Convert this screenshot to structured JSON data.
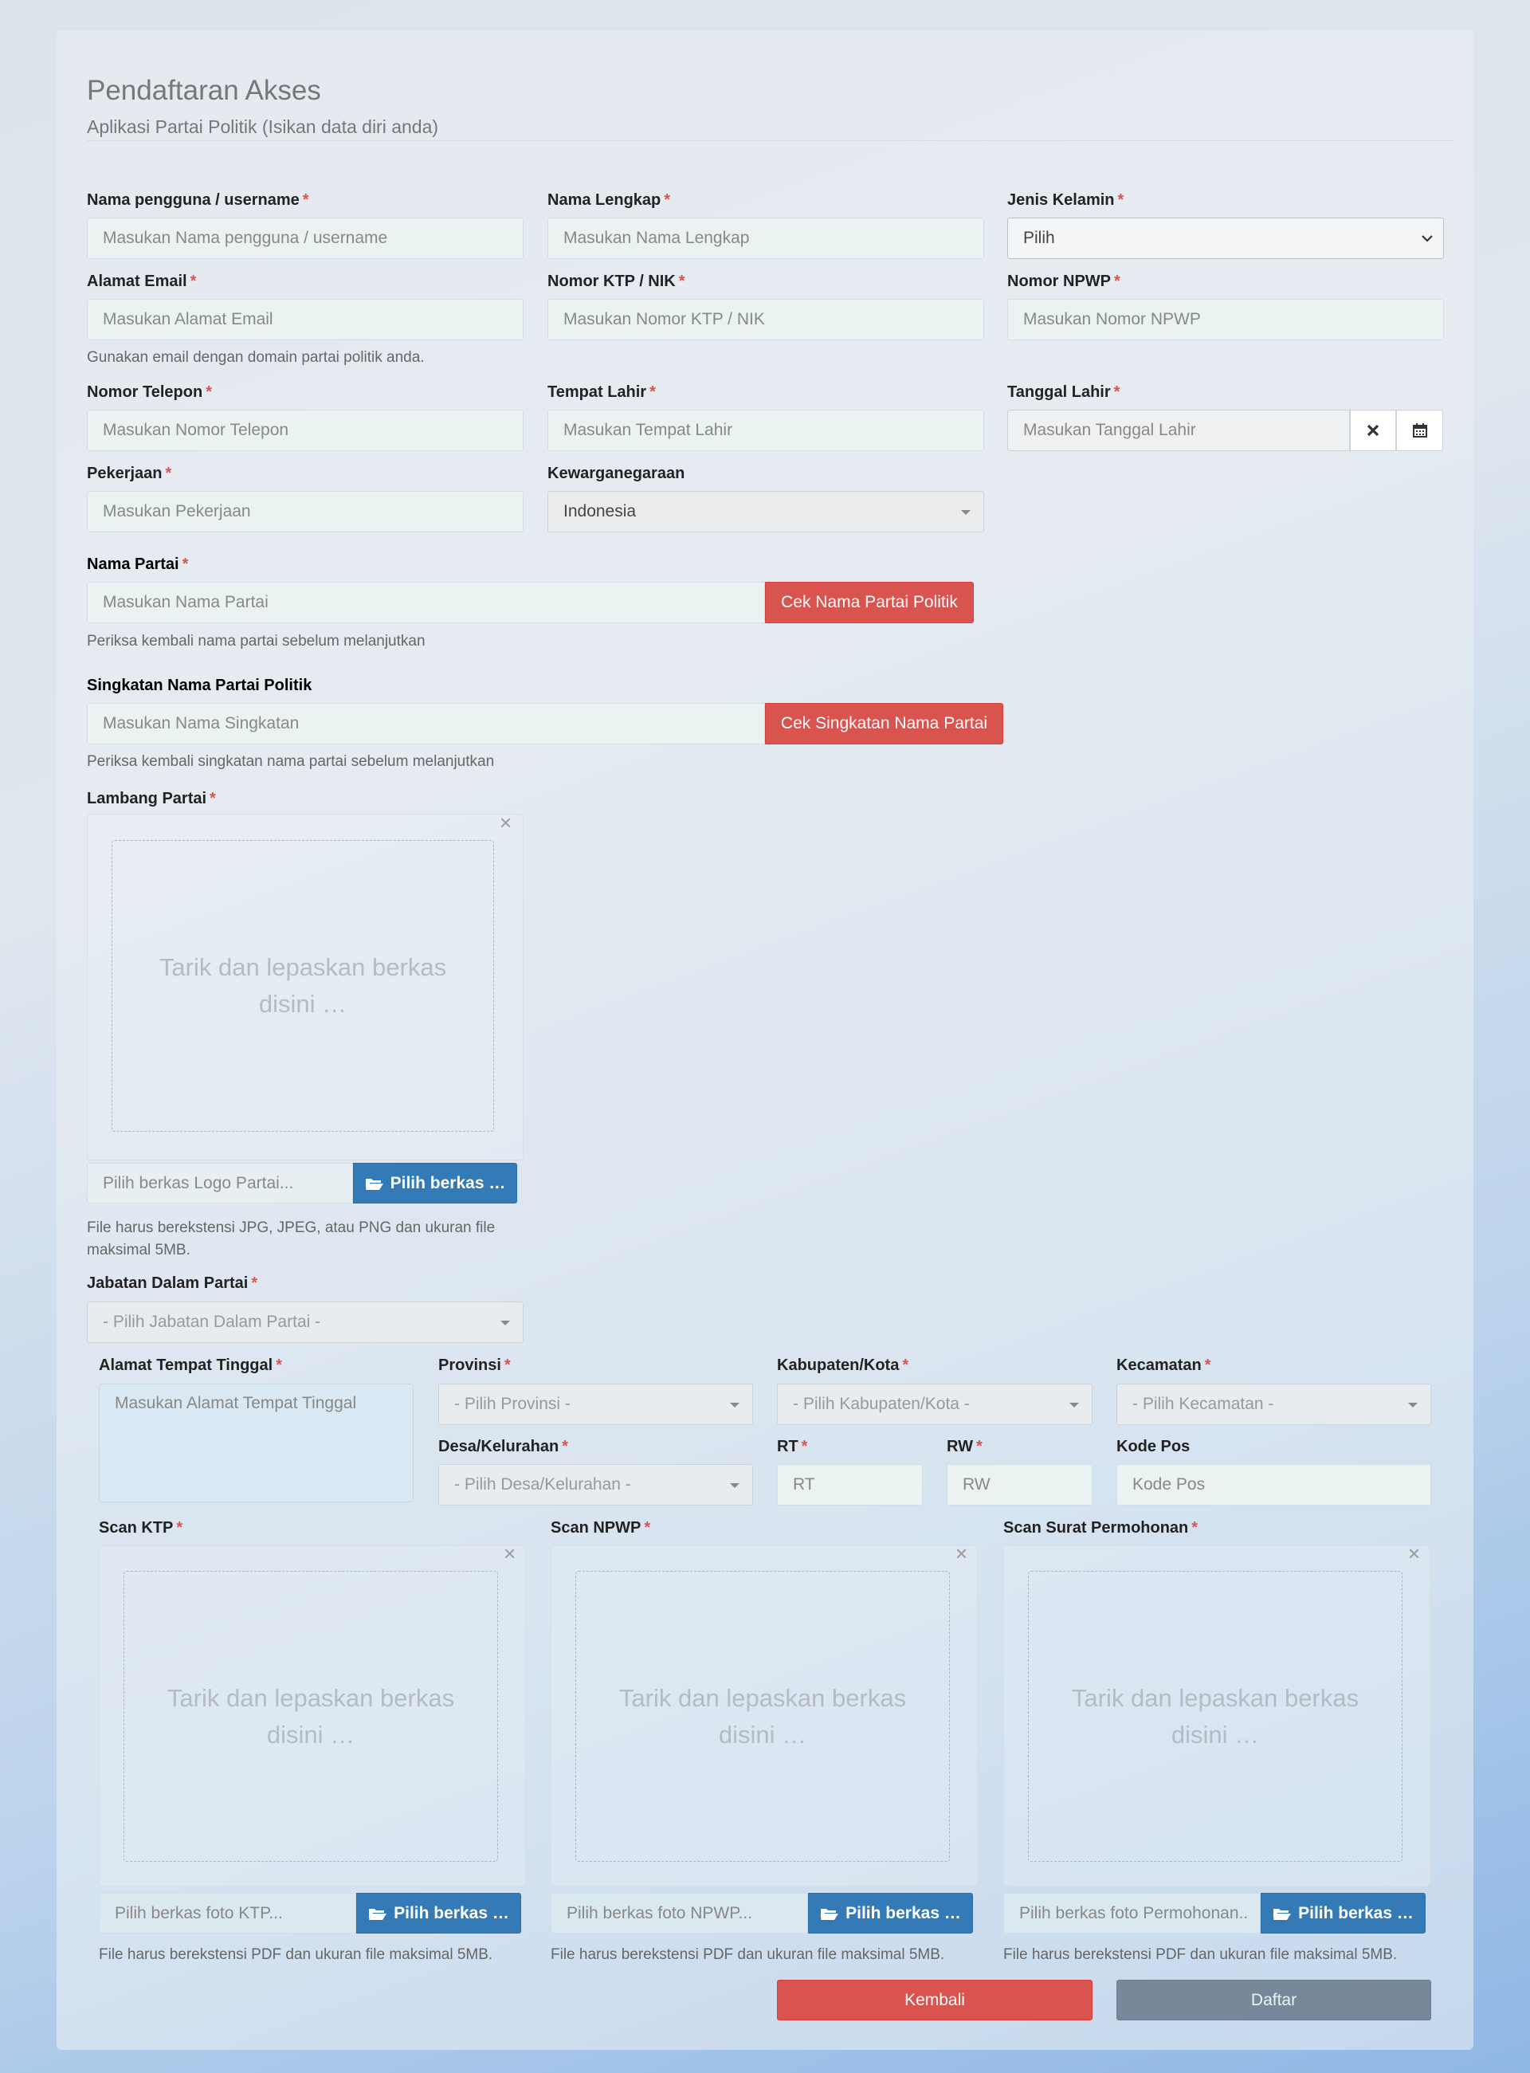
{
  "header": {
    "title": "Pendaftaran Akses",
    "subtitle": "Aplikasi Partai Politik (Isikan data diri anda)"
  },
  "required_mark": "*",
  "fields": {
    "username": {
      "label": "Nama pengguna / username",
      "placeholder": "Masukan Nama pengguna / username"
    },
    "fullname": {
      "label": "Nama Lengkap",
      "placeholder": "Masukan Nama Lengkap"
    },
    "gender": {
      "label": "Jenis Kelamin",
      "value": "Pilih"
    },
    "email": {
      "label": "Alamat Email",
      "placeholder": "Masukan Alamat Email",
      "help": "Gunakan email dengan domain partai politik anda."
    },
    "ktp": {
      "label": "Nomor KTP / NIK",
      "placeholder": "Masukan Nomor KTP / NIK"
    },
    "npwp": {
      "label": "Nomor NPWP",
      "placeholder": "Masukan Nomor NPWP"
    },
    "phone": {
      "label": "Nomor Telepon",
      "placeholder": "Masukan Nomor Telepon"
    },
    "birthplace": {
      "label": "Tempat Lahir",
      "placeholder": "Masukan Tempat Lahir"
    },
    "birthdate": {
      "label": "Tanggal Lahir",
      "placeholder": "Masukan Tanggal Lahir"
    },
    "job": {
      "label": "Pekerjaan",
      "placeholder": "Masukan Pekerjaan"
    },
    "citizenship": {
      "label": "Kewarganegaraan",
      "value": "Indonesia"
    },
    "party_name": {
      "label": "Nama Partai",
      "placeholder": "Masukan Nama Partai",
      "button": "Cek Nama Partai Politik",
      "help": "Periksa kembali nama partai sebelum melanjutkan"
    },
    "party_abbr": {
      "label": "Singkatan Nama Partai Politik",
      "placeholder": "Masukan Nama Singkatan",
      "button": "Cek Singkatan Nama Partai",
      "help": "Periksa kembali singkatan nama partai sebelum melanjutkan"
    },
    "logo": {
      "label": "Lambang Partai",
      "drop_line1": "Tarik dan lepaskan berkas",
      "drop_line2": "disini …",
      "file_placeholder": "Pilih berkas Logo Partai...",
      "browse": "Pilih berkas …",
      "help_line1": "File harus berekstensi JPG, JPEG, atau PNG dan ukuran file",
      "help_line2": "maksimal 5MB."
    },
    "position": {
      "label": "Jabatan Dalam Partai",
      "value": "- Pilih Jabatan Dalam Partai -"
    },
    "address": {
      "label": "Alamat Tempat Tinggal",
      "placeholder": "Masukan Alamat Tempat Tinggal"
    },
    "province": {
      "label": "Provinsi",
      "value": "- Pilih Provinsi -"
    },
    "city": {
      "label": "Kabupaten/Kota",
      "value": "- Pilih Kabupaten/Kota -"
    },
    "district": {
      "label": "Kecamatan",
      "value": "- Pilih Kecamatan -"
    },
    "village": {
      "label": "Desa/Kelurahan",
      "value": "- Pilih Desa/Kelurahan -"
    },
    "rt": {
      "label": "RT",
      "placeholder": "RT"
    },
    "rw": {
      "label": "RW",
      "placeholder": "RW"
    },
    "postal": {
      "label": "Kode Pos",
      "placeholder": "Kode Pos"
    },
    "scan_ktp": {
      "label": "Scan KTP",
      "file_placeholder": "Pilih berkas foto KTP...",
      "browse": "Pilih berkas …",
      "help": "File harus berekstensi PDF dan ukuran file maksimal 5MB."
    },
    "scan_npwp": {
      "label": "Scan NPWP",
      "file_placeholder": "Pilih berkas foto NPWP...",
      "browse": "Pilih berkas …",
      "help": "File harus berekstensi PDF dan ukuran file maksimal 5MB."
    },
    "scan_letter": {
      "label": "Scan Surat Permohonan",
      "file_placeholder": "Pilih berkas foto Permohonan..",
      "browse": "Pilih berkas …",
      "help": "File harus berekstensi PDF dan ukuran file maksimal 5MB."
    }
  },
  "dropzone": {
    "line1": "Tarik dan lepaskan berkas",
    "line2": "disini …",
    "close": "×"
  },
  "icons": {
    "clear": "times-icon",
    "calendar": "calendar-icon",
    "folder": "folder-open-icon",
    "close": "close-icon"
  },
  "actions": {
    "back": "Kembali",
    "submit": "Daftar"
  },
  "colors": {
    "danger": "#d9534f",
    "primary": "#337ab7",
    "disabled": "#77889a"
  }
}
